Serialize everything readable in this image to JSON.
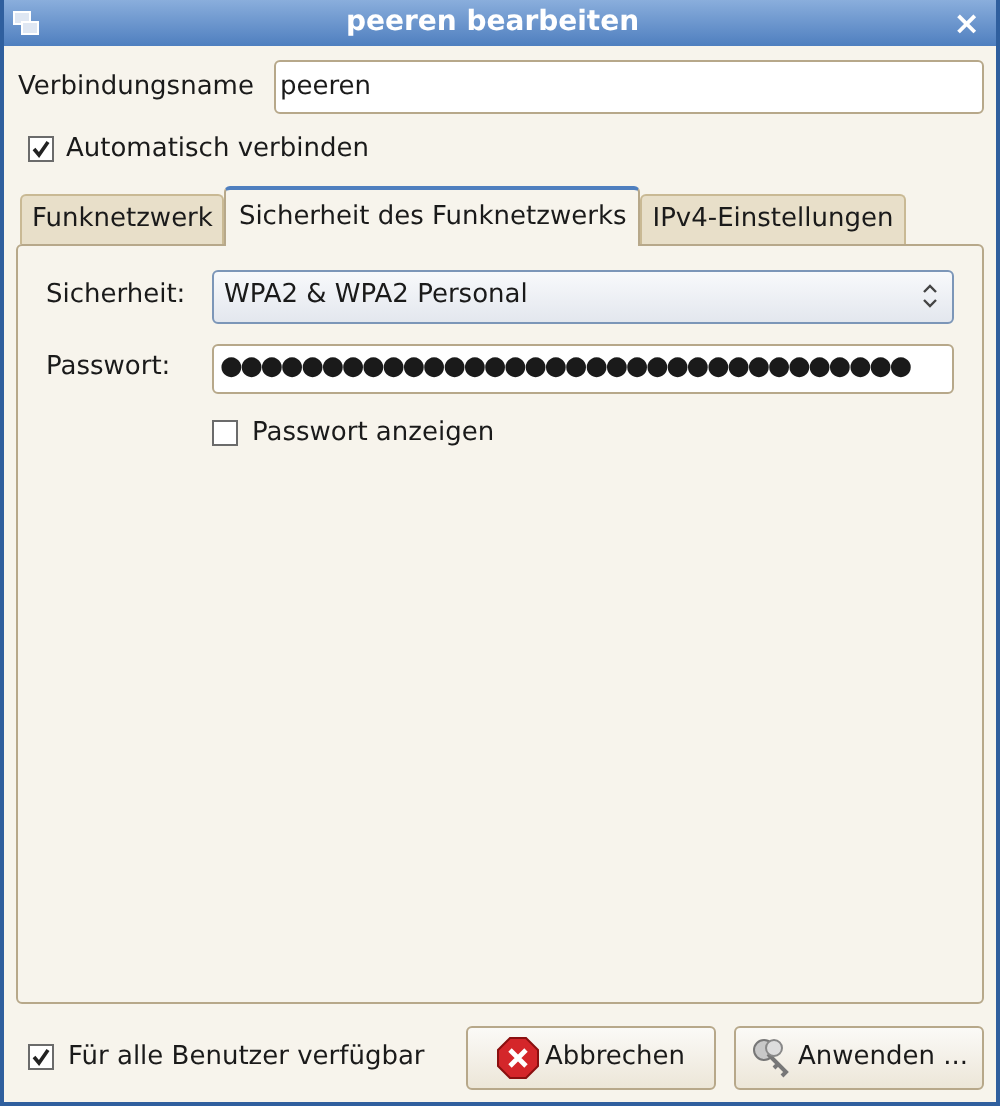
{
  "window": {
    "title": "peeren bearbeiten",
    "close": "×"
  },
  "connection_name": {
    "label": "Verbindungsname",
    "value": "peeren"
  },
  "auto_connect": {
    "label": "Automatisch verbinden",
    "checked": true
  },
  "tabs": [
    {
      "label": "Funknetzwerk",
      "selected": false
    },
    {
      "label": "Sicherheit des Funknetzwerks",
      "selected": true
    },
    {
      "label": "IPv4-Einstellungen",
      "selected": false
    }
  ],
  "security": {
    "label": "Sicherheit:",
    "value": "WPA2 & WPA2 Personal"
  },
  "password": {
    "label": "Passwort:",
    "value": "●●●●●●●●●●●●●●●●●●●●●●●●●●●●●●●●●●"
  },
  "show_password": {
    "label": "Passwort anzeigen",
    "checked": false
  },
  "all_users": {
    "label": "Für alle Benutzer verfügbar",
    "checked": true
  },
  "buttons": [
    {
      "label": "Abbrechen",
      "kind": "cancel"
    },
    {
      "label": "Anwenden ...",
      "kind": "apply"
    }
  ]
}
